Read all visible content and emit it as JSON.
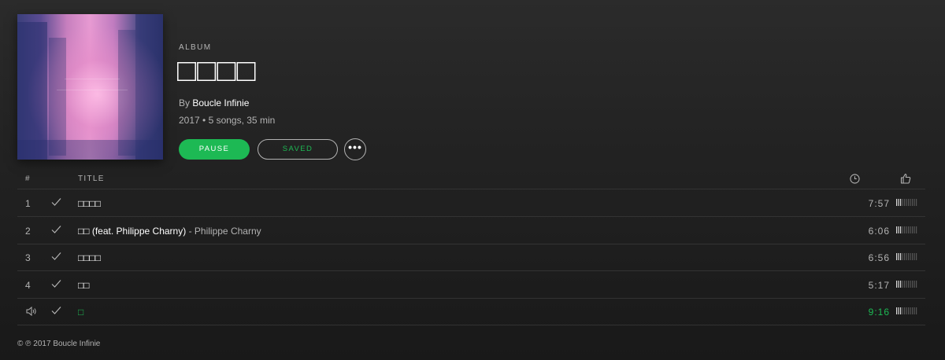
{
  "album": {
    "kind": "ALBUM",
    "title": "□□□□",
    "by_prefix": "By",
    "artist": "Boucle Infinie",
    "meta": "2017 • 5 songs, 35 min",
    "pause_label": "PAUSE",
    "saved_label": "SAVED",
    "more_label": "•••"
  },
  "table": {
    "col_num": "#",
    "col_title": "TITLE"
  },
  "tracks": [
    {
      "number": "1",
      "title": "□□□□",
      "featuring": "",
      "duration": "7:57",
      "popularity": 0.3,
      "playing": false
    },
    {
      "number": "2",
      "title": "□□ (feat. Philippe Charny)",
      "featuring": "- Philippe Charny",
      "duration": "6:06",
      "popularity": 0.3,
      "playing": false
    },
    {
      "number": "3",
      "title": "□□□□",
      "featuring": "",
      "duration": "6:56",
      "popularity": 0.3,
      "playing": false
    },
    {
      "number": "4",
      "title": "□□",
      "featuring": "",
      "duration": "5:17",
      "popularity": 0.3,
      "playing": false
    },
    {
      "number": "",
      "title": "□",
      "featuring": "",
      "duration": "9:16",
      "popularity": 0.3,
      "playing": true
    }
  ],
  "copyright": "© ℗ 2017 Boucle Infinie",
  "colors": {
    "accent": "#1db954",
    "text": "#ffffff",
    "muted": "#b3b3b3"
  },
  "icons": {
    "clock": "clock-icon",
    "thumb": "thumbs-up-icon",
    "check": "check-icon",
    "speaker": "speaker-icon",
    "more": "more-icon"
  }
}
